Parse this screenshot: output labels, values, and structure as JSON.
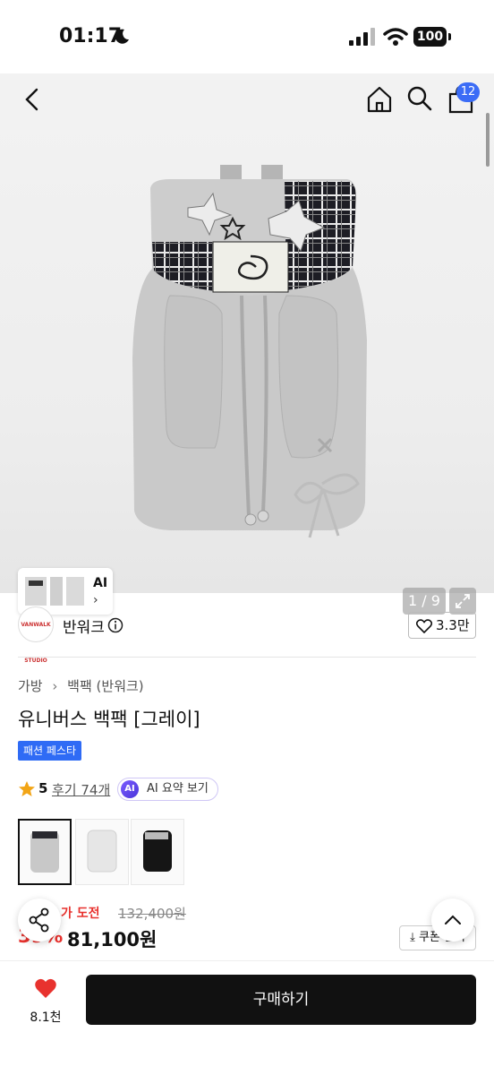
{
  "status_bar": {
    "time": "01:17",
    "battery": "100"
  },
  "header": {
    "cart_count": "12"
  },
  "gallery": {
    "thumb_label": "AI",
    "thumb_arrow": "›",
    "pager": "1 / 9"
  },
  "brand": {
    "name": "반워크",
    "logo_text": "VANWALK STUDIO",
    "likes": "3.3만"
  },
  "breadcrumb": {
    "items": [
      "가방",
      "백팩 (반워크)"
    ]
  },
  "product": {
    "title": "유니버스 백팩 [그레이]",
    "event_badge": "패션 페스타",
    "rating": "5",
    "review_link": "후기 74개",
    "ai_badge": "AI",
    "ai_summary": "AI 요약 보기"
  },
  "price": {
    "label": "가 도전",
    "original": "132,400원",
    "discount": "39%",
    "sale": "81,100원",
    "coupon": "쿠폰 받기"
  },
  "bottom": {
    "wish_count": "8.1천",
    "buy_label": "구매하기"
  },
  "colors": {
    "accent_blue": "#2f6bf5",
    "sale_red": "#e8322e",
    "buy_black": "#111111"
  }
}
